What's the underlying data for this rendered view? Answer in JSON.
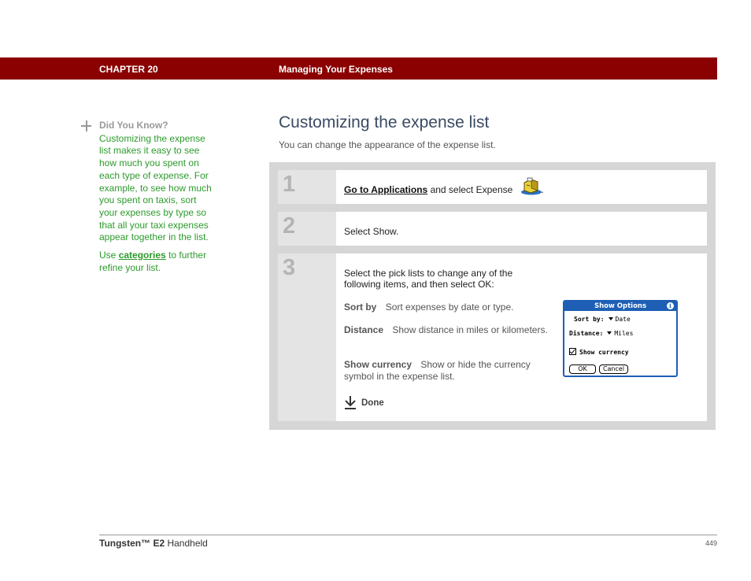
{
  "header": {
    "chapter": "CHAPTER 20",
    "section": "Managing Your Expenses"
  },
  "sidebar": {
    "title": "Did You Know?",
    "tip": "Customizing the expense list makes it easy to see how much you spent on each type of expense. For example, to see how much you spent on taxis, sort your expenses by type so that all your taxi expenses appear together in the list.",
    "use_prefix": "Use",
    "use_link": "categories",
    "use_suffix": "to further refine your list.",
    "icon": "plus-icon"
  },
  "page": {
    "title": "Customizing the expense list",
    "intro": "You can change the appearance of the expense list."
  },
  "steps": [
    {
      "number": "1",
      "link": "Go to Applications",
      "text": "and select Expense",
      "end": ".",
      "icon": "expense-app-icon"
    },
    {
      "number": "2",
      "text": "Select Show."
    },
    {
      "number": "3",
      "text": "Select the pick lists to change any of the following items, and then select OK:"
    }
  ],
  "options": [
    {
      "label": "Sort by",
      "desc": "Sort expenses by date or type."
    },
    {
      "label": "Distance",
      "desc": "Show distance in miles or kilometers."
    },
    {
      "label": "Show currency",
      "desc": "Show or hide the currency symbol in the expense list."
    }
  ],
  "done_label": "Done",
  "dialog": {
    "title": "Show Options",
    "info": "i",
    "sort_label": "Sort by:",
    "sort_value": "Date",
    "distance_label": "Distance:",
    "distance_value": "Miles",
    "currency_label": "Show currency",
    "currency_checked": true,
    "ok": "OK",
    "cancel": "Cancel"
  },
  "footer": {
    "product_bold": "Tungsten™ E2",
    "product_rest": "Handheld",
    "page_number": "449"
  },
  "colors": {
    "header_bg": "#8b0000",
    "sidebar_text": "#2c9a2c",
    "title_text": "#3a4a63",
    "dialog_blue": "#1e5fb5"
  }
}
